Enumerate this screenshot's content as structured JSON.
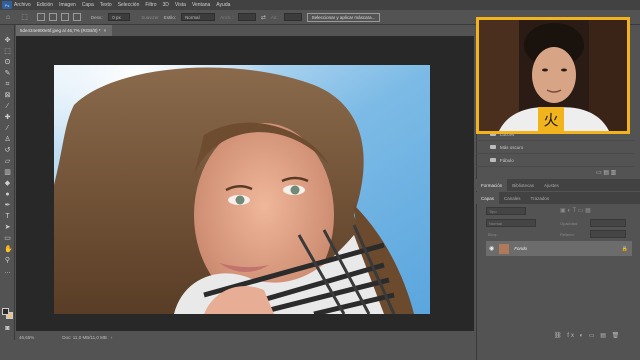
{
  "menu": {
    "items": [
      "Archivo",
      "Edición",
      "Imagen",
      "Capa",
      "Texto",
      "Selección",
      "Filtro",
      "3D",
      "Vista",
      "Ventana",
      "Ayuda"
    ]
  },
  "options": {
    "desvanecer_label": "Desv.:",
    "desvanecer_value": "0 px",
    "suavizar": "Suavizar",
    "estilo_label": "Estilo:",
    "estilo_value": "Normal",
    "anchura": "Anch.:",
    "altura": "Alt.:",
    "mask_button": "Seleccionar y aplicar máscara..."
  },
  "document": {
    "tab_title": "5de434e900e5f.jpeg al 46,7% (RGB/8) *",
    "zoom": "46,65%",
    "doc_info": "Doc: 11,0 MB/11,0 MB"
  },
  "folders": [
    "Lucces",
    "Más oscuro",
    "Fábulo"
  ],
  "panel_tabs": [
    "Formación",
    "Bibliotecas",
    "Ajustes"
  ],
  "layer_tabs": [
    "Capas",
    "Canales",
    "Trazados"
  ],
  "layer_fields": {
    "kind": "Tipo",
    "blend": "Normal",
    "opacity": "Opacidad:",
    "lock": "Bloq.:",
    "fill": "Relleno:"
  },
  "layer": {
    "name": "Fondo"
  },
  "webcam": {
    "badge_glyph": "火"
  },
  "colors": {
    "accent_frame": "#f2b41c",
    "ui_dark": "#424242",
    "ui_mid": "#535353",
    "canvas_bg": "#282828"
  }
}
